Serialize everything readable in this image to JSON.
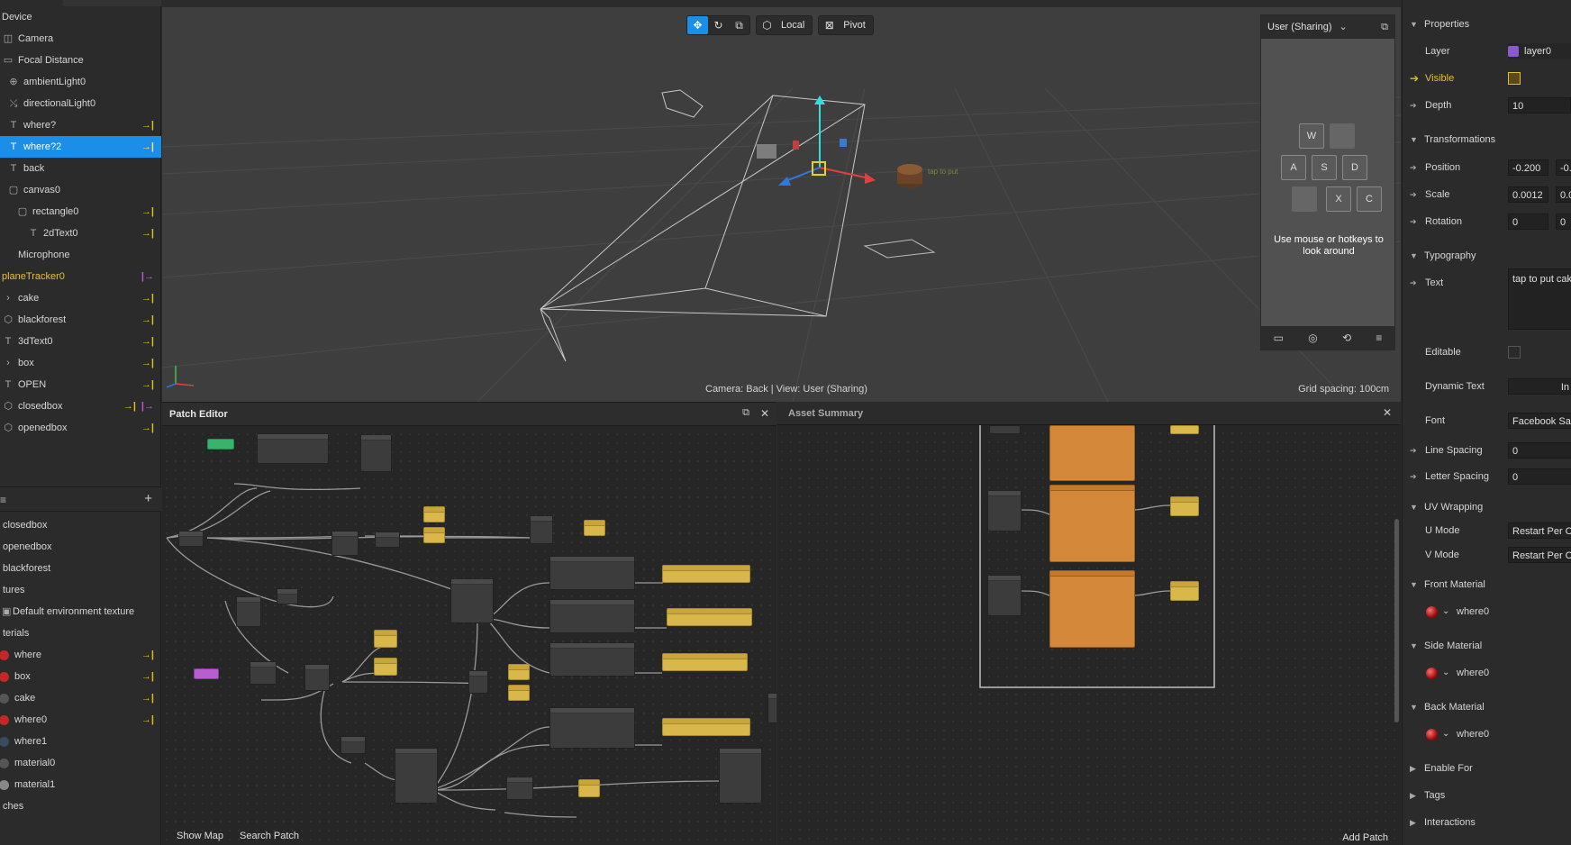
{
  "scene": {
    "items": [
      {
        "label": "Device",
        "icon": "",
        "flag": ""
      },
      {
        "label": "Camera",
        "icon": "camera",
        "flag": ""
      },
      {
        "label": "Focal Distance",
        "icon": "focal",
        "flag": ""
      },
      {
        "label": "ambientLight0",
        "icon": "globe",
        "flag": ""
      },
      {
        "label": "directionalLight0",
        "icon": "light",
        "flag": ""
      },
      {
        "label": "where?",
        "icon": "text",
        "flag": "→|"
      },
      {
        "label": "where?2",
        "icon": "text",
        "flag": "→|"
      },
      {
        "label": "back",
        "icon": "text",
        "flag": ""
      },
      {
        "label": "canvas0",
        "icon": "canvas",
        "flag": ""
      },
      {
        "label": "rectangle0",
        "icon": "rect",
        "flag": "→|"
      },
      {
        "label": "2dText0",
        "icon": "text",
        "flag": "→|"
      },
      {
        "label": "Microphone",
        "icon": "mic",
        "flag": ""
      },
      {
        "label": "planeTracker0",
        "icon": "",
        "flag": "|→"
      },
      {
        "label": "cake",
        "icon": "arrow",
        "flag": "→|"
      },
      {
        "label": "blackforest",
        "icon": "cube",
        "flag": "→|"
      },
      {
        "label": "3dText0",
        "icon": "text",
        "flag": "→|"
      },
      {
        "label": "box",
        "icon": "arrow",
        "flag": "→|"
      },
      {
        "label": "OPEN",
        "icon": "text",
        "flag": "→|"
      },
      {
        "label": "closedbox",
        "icon": "cube",
        "flag": "→|",
        "flag_extra": "|→"
      },
      {
        "label": "openedbox",
        "icon": "cube",
        "flag": "→|"
      }
    ],
    "selected_index": 6,
    "assets": [
      {
        "label": "closedbox"
      },
      {
        "label": "openedbox"
      },
      {
        "label": "blackforest"
      },
      {
        "label": "tures"
      },
      {
        "label": "Default environment texture"
      },
      {
        "label": "terials"
      },
      {
        "label": "where",
        "swatch": "#c0282a",
        "flag": "→|"
      },
      {
        "label": "box",
        "swatch": "#c0282a",
        "flag": "→|"
      },
      {
        "label": "cake",
        "swatch": "#555555",
        "flag": "→|"
      },
      {
        "label": "where0",
        "swatch": "#c0282a",
        "flag": "→|"
      },
      {
        "label": "where1",
        "swatch": "#3a4a60",
        "flag": ""
      },
      {
        "label": "material0",
        "swatch": "#555555",
        "flag": ""
      },
      {
        "label": "material1",
        "swatch": "#888888",
        "flag": ""
      },
      {
        "label": "ches"
      }
    ]
  },
  "viewport": {
    "toolbar": {
      "local": "Local",
      "pivot": "Pivot"
    },
    "caption": "Camera: Back | View: User (Sharing)",
    "grid": "Grid spacing: 100cm",
    "preview": {
      "title": "User (Sharing)",
      "keys": [
        "W",
        "A",
        "S",
        "D",
        "X",
        "C"
      ],
      "hint": "Use mouse or hotkeys to look around"
    }
  },
  "patch_editor": {
    "title": "Patch Editor",
    "show_map": "Show Map",
    "search_patch": "Search Patch"
  },
  "asset_summary": {
    "title": "Asset Summary",
    "add_patch": "Add Patch"
  },
  "inspector": {
    "properties": "Properties",
    "layer_label": "Layer",
    "layer_value": "layer0",
    "visible_label": "Visible",
    "depth_label": "Depth",
    "depth_value": "10",
    "transformations": "Transformations",
    "position_label": "Position",
    "position_x": "-0.200",
    "position_y": "-0.",
    "scale_label": "Scale",
    "scale_x": "0.0012",
    "scale_y": "0.0",
    "rotation_label": "Rotation",
    "rotation_x": "0",
    "rotation_y": "0",
    "typography": "Typography",
    "text_label": "Text",
    "text_value": "tap to put cak",
    "editable_label": "Editable",
    "dynamic_label": "Dynamic Text",
    "dynamic_value": "In",
    "font_label": "Font",
    "font_value": "Facebook San",
    "line_spacing_label": "Line Spacing",
    "line_spacing_value": "0",
    "letter_spacing_label": "Letter Spacing",
    "letter_spacing_value": "0",
    "uv": "UV Wrapping",
    "umode_label": "U Mode",
    "umode_value": "Restart Per Cl",
    "vmode_label": "V Mode",
    "vmode_value": "Restart Per Cl",
    "front_material": "Front Material",
    "front_value": "where0",
    "side_material": "Side Material",
    "side_value": "where0",
    "back_material": "Back Material",
    "back_value": "where0",
    "enable_for": "Enable For",
    "tags": "Tags",
    "interactions": "Interactions"
  },
  "colors": {
    "accent": "#1b8fe7",
    "flag": "#e0c020",
    "node_yellow": "#d9b84b",
    "node_orange": "#d4893a"
  }
}
